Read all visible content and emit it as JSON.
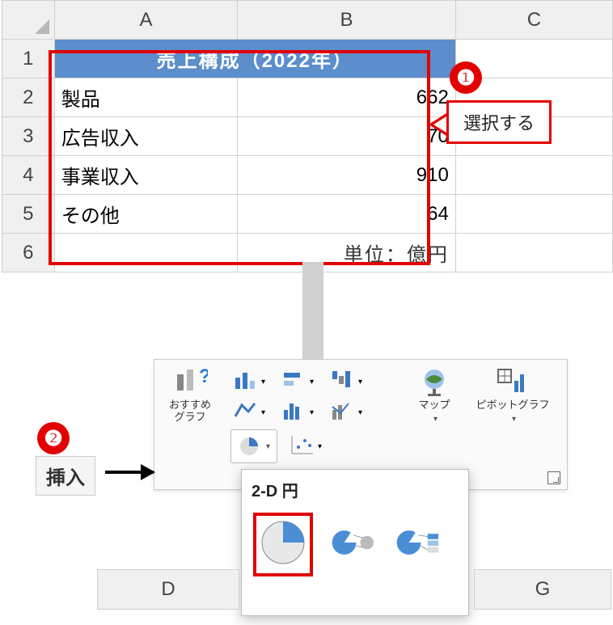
{
  "columns": {
    "A": "A",
    "B": "B",
    "C": "C",
    "D": "D",
    "G": "G"
  },
  "rows": {
    "r1": "1",
    "r2": "2",
    "r3": "3",
    "r4": "4",
    "r5": "5",
    "r6": "6"
  },
  "title_merged": "売上構成（2022年）",
  "data": {
    "r2": {
      "label": "製品",
      "value": "662"
    },
    "r3": {
      "label": "広告収入",
      "value": "70"
    },
    "r4": {
      "label": "事業収入",
      "value": "910"
    },
    "r5": {
      "label": "その他",
      "value": "64"
    }
  },
  "unit_label": "単位：億円",
  "badge1": "❶",
  "badge2": "❷",
  "callout_text": "選択する",
  "insert_tab": "挿入",
  "ribbon": {
    "recommend": "おすすめ\nグラフ",
    "maps": "マップ",
    "pivot": "ピボットグラフ"
  },
  "popup": {
    "section": "2-D 円"
  },
  "chart_data": {
    "type": "pie",
    "title": "売上構成（2022年）",
    "categories": [
      "製品",
      "広告収入",
      "事業収入",
      "その他"
    ],
    "values": [
      662,
      70,
      910,
      64
    ],
    "unit": "億円"
  }
}
